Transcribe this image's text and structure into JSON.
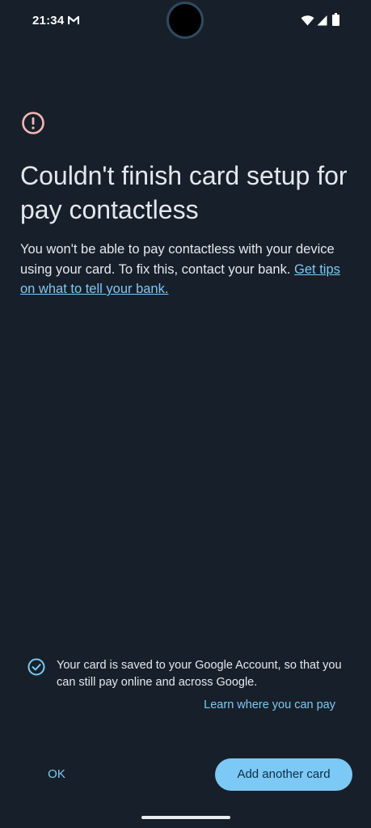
{
  "status_bar": {
    "time": "21:34"
  },
  "error_page": {
    "title": "Couldn't finish card setup for pay contactless",
    "body": "You won't be able to pay contactless with your device using your card. To fix this, contact your bank. ",
    "tips_link": "Get tips on what to tell your bank."
  },
  "saved_notice": {
    "text": "Your card is saved to your Google Account, so that you can still pay online and across Google.",
    "learn_link": "Learn where you can pay"
  },
  "actions": {
    "ok_label": "OK",
    "add_label": "Add another card"
  },
  "colors": {
    "background": "#17202a",
    "accent": "#7cc9f5",
    "alert": "#f2b8b5"
  },
  "icons": [
    "gmail-icon",
    "wifi-icon",
    "signal-icon",
    "battery-icon",
    "alert-icon",
    "check-circle-icon"
  ]
}
